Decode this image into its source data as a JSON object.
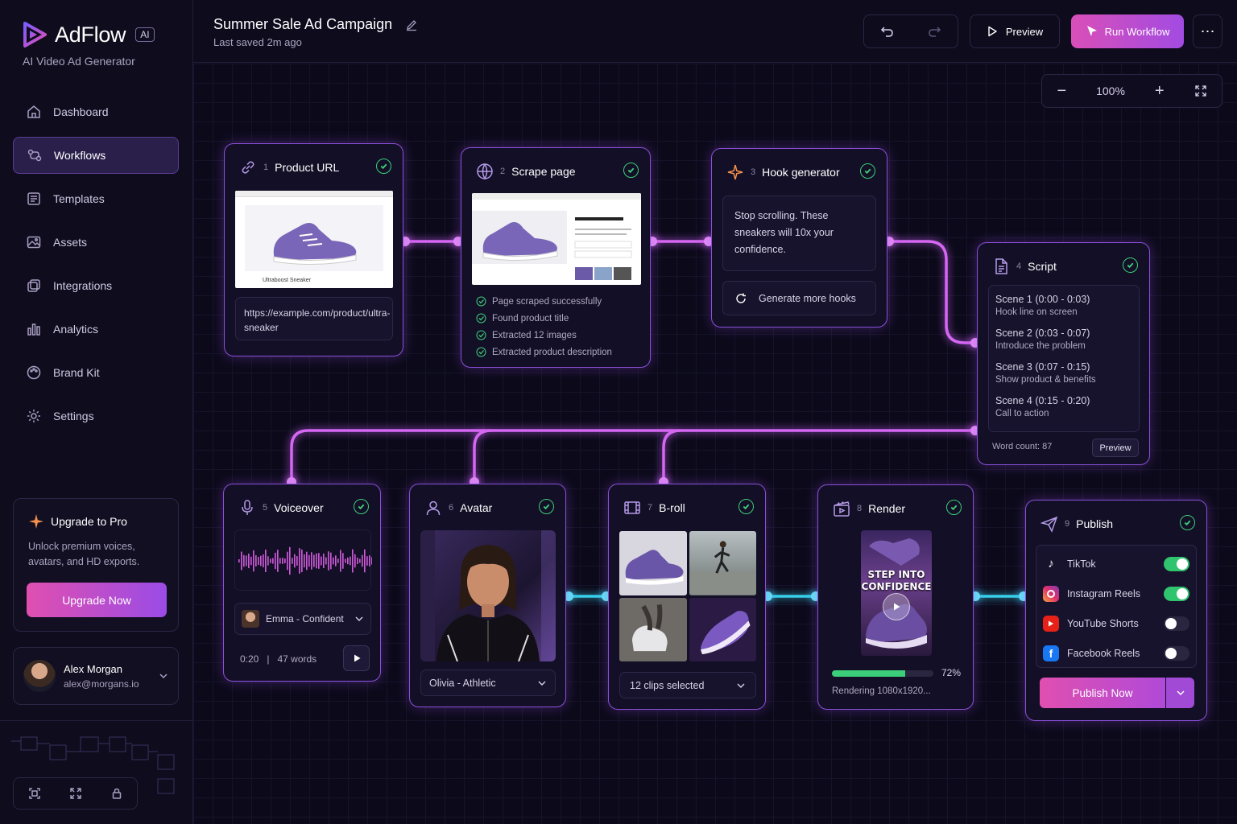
{
  "brand": {
    "name": "AdFlow",
    "badge": "AI",
    "subtitle": "AI Video Ad Generator"
  },
  "sidebar": {
    "items": [
      {
        "label": "Dashboard"
      },
      {
        "label": "Workflows"
      },
      {
        "label": "Templates"
      },
      {
        "label": "Assets"
      },
      {
        "label": "Integrations"
      },
      {
        "label": "Analytics"
      },
      {
        "label": "Brand Kit"
      },
      {
        "label": "Settings"
      }
    ],
    "active": "Workflows"
  },
  "upgrade": {
    "title": "Upgrade to Pro",
    "desc": "Unlock premium voices, avatars, and HD exports.",
    "button": "Upgrade Now"
  },
  "user": {
    "name": "Alex Morgan",
    "email": "alex@morgans.io"
  },
  "header": {
    "title": "Summer Sale Ad Campaign",
    "saved": "Last saved 2m ago",
    "preview": "Preview",
    "run": "Run Workflow"
  },
  "zoom": {
    "level": "100%"
  },
  "nodes": {
    "product_url": {
      "num": "1",
      "title": "Product URL",
      "url": "https://example.com/product/ultra-sneaker",
      "page_caption": "Ultraboost Sneaker"
    },
    "scrape": {
      "num": "2",
      "title": "Scrape page",
      "steps": [
        "Page scraped successfully",
        "Found product title",
        "Extracted 12 images",
        "Extracted product description"
      ]
    },
    "hook": {
      "num": "3",
      "title": "Hook generator",
      "text": "Stop scrolling. These sneakers will 10x your confidence.",
      "button": "Generate more hooks"
    },
    "script": {
      "num": "4",
      "title": "Script",
      "scenes": [
        {
          "name": "Scene 1",
          "time": "(0:00 - 0:03)",
          "desc": "Hook line on screen"
        },
        {
          "name": "Scene 2",
          "time": "(0:03 - 0:07)",
          "desc": "Introduce the problem"
        },
        {
          "name": "Scene 3",
          "time": "(0:07 - 0:15)",
          "desc": "Show product & benefits"
        },
        {
          "name": "Scene 4",
          "time": "(0:15 - 0:20)",
          "desc": "Call to action"
        }
      ],
      "word_count": "Word count: 87",
      "preview": "Preview"
    },
    "voice": {
      "num": "5",
      "title": "Voiceover",
      "voice": "Emma - Confident",
      "duration": "0:20",
      "words": "47 words"
    },
    "avatar": {
      "num": "6",
      "title": "Avatar",
      "selected": "Olivia - Athletic"
    },
    "broll": {
      "num": "7",
      "title": "B-roll",
      "selected": "12 clips selected"
    },
    "render": {
      "num": "8",
      "title": "Render",
      "overlay": "STEP INTO CONFIDENCE",
      "progress": 0.72,
      "percent": "72%",
      "status": "Rendering 1080x1920..."
    },
    "publish": {
      "num": "9",
      "title": "Publish",
      "platforms": [
        {
          "name": "TikTok",
          "on": true
        },
        {
          "name": "Instagram Reels",
          "on": true
        },
        {
          "name": "YouTube Shorts",
          "on": false
        },
        {
          "name": "Facebook Reels",
          "on": false
        }
      ],
      "button": "Publish Now"
    }
  },
  "colors": {
    "accent": "#a24be2",
    "pink": "#e04fb0",
    "wire_purple": "#d567f2",
    "wire_cyan": "#38cfea",
    "success": "#3ccf7a"
  }
}
